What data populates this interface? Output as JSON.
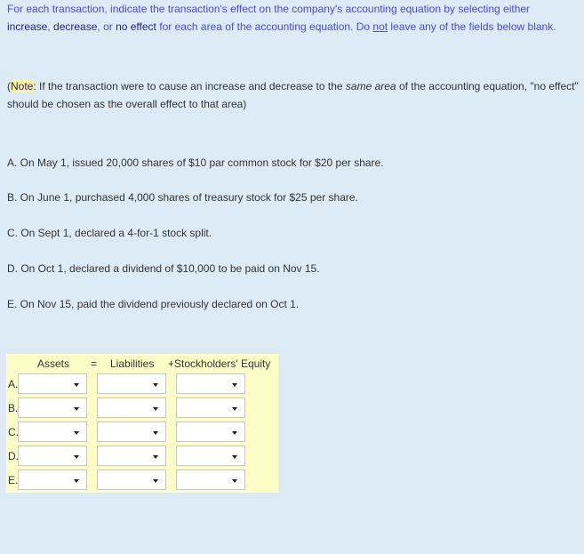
{
  "instructions": {
    "part1": "For each transaction, indicate the transaction's effect on the company's accounting equation by selecting either ",
    "kw_increase": "increase",
    "sep1": ", ",
    "kw_decrease": "decrease",
    "sep2": ", or ",
    "kw_no_effect": "no effect",
    "part2": " for each area of the accounting equation. Do ",
    "not": "not",
    "part3": " leave any of the fields below blank."
  },
  "note": {
    "label": "Note",
    "open": "(",
    "text1": ": If the transaction were to cause an increase and decrease to the ",
    "emph": "same area",
    "text2": " of the accounting equation, \"no effect\" should be chosen as the overall effect to that area)"
  },
  "transactions": [
    "A. On May 1, issued 20,000 shares of $10 par common stock for $20 per share.",
    "B. On June 1, purchased 4,000 shares of treasury stock for $25 per share.",
    "C. On Sept 1, declared a 4-for-1 stock split.",
    "D. On Oct 1, declared a dividend of $10,000 to be paid on Nov 15.",
    "E. On Nov 15, paid the dividend previously declared on Oct 1."
  ],
  "table": {
    "headers": {
      "assets": "Assets",
      "equals": "=",
      "liabilities": "Liabilities",
      "plus_equity": "+Stockholders' Equity"
    },
    "rows": [
      {
        "label": "A.",
        "assets": "",
        "liabilities": "",
        "equity": ""
      },
      {
        "label": "B.",
        "assets": "",
        "liabilities": "",
        "equity": ""
      },
      {
        "label": "C.",
        "assets": "",
        "liabilities": "",
        "equity": ""
      },
      {
        "label": "D.",
        "assets": "",
        "liabilities": "",
        "equity": ""
      },
      {
        "label": "E.",
        "assets": "",
        "liabilities": "",
        "equity": ""
      }
    ]
  },
  "colors": {
    "background": "#dcebf6",
    "instruction_text": "#4a4ad8",
    "keyword_text": "#1f1f8f",
    "note_highlight": "#fcf59c",
    "table_background": "#fdfdc8"
  }
}
